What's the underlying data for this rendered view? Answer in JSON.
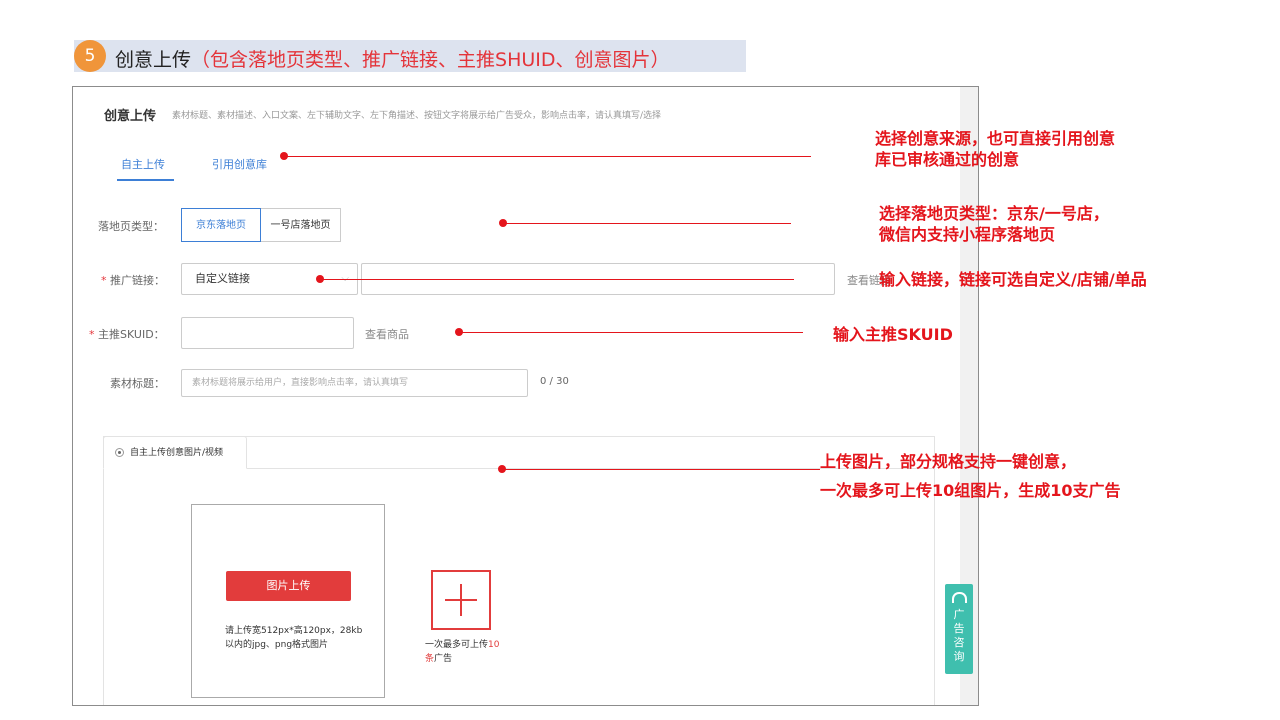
{
  "step": {
    "number": "5",
    "title": "创意上传",
    "subtitle": "（包含落地页类型、推广链接、主推SHUID、创意图片）"
  },
  "section": {
    "title": "创意上传",
    "description": "素材标题、素材描述、入口文案、左下辅助文字、左下角描述、按钮文字将展示给广告受众，影响点击率，请认真填写/选择"
  },
  "tabs": [
    {
      "label": "自主上传",
      "active": true
    },
    {
      "label": "引用创意库",
      "active": false
    }
  ],
  "form": {
    "landing_label": "落地页类型：",
    "landing_options": [
      "京东落地页",
      "一号店落地页"
    ],
    "landing_selected": "京东落地页",
    "link_required": "*",
    "link_label": "推广链接：",
    "link_select_value": "自定义链接",
    "link_view": "查看链接",
    "sku_required": "*",
    "sku_label": "主推SKUID：",
    "sku_view": "查看商品",
    "title_label": "素材标题：",
    "title_placeholder": "素材标题将展示给用户，直接影响点击率，请认真填写",
    "title_counter": "0 / 30"
  },
  "upload": {
    "tab_label": "自主上传创意图片/视频",
    "button_label": "图片上传",
    "hint": "请上传宽512px*高120px，28kb以内的jpg、png格式图片",
    "add_hint_prefix": "一次最多可上传",
    "add_hint_count": "10条",
    "add_hint_suffix": "广告"
  },
  "side_button": {
    "label": "广告咨询",
    "icon": "headset-icon"
  },
  "annotations": {
    "source": [
      "选择创意来源，也可直接引用创意",
      "库已审核通过的创意"
    ],
    "landing": [
      "选择落地页类型：京东/一号店，",
      "微信内支持小程序落地页"
    ],
    "link": "输入链接，链接可选自定义/店铺/单品",
    "sku": "输入主推SKUID",
    "upload": [
      "上传图片，部分规格支持一键创意，",
      "一次最多可上传10组图片，生成10支广告"
    ]
  },
  "colors": {
    "accent_blue": "#3d7fd6",
    "annotation_red": "#e4151c",
    "badge_orange": "#f0953a",
    "side_teal": "#3fbfae"
  }
}
